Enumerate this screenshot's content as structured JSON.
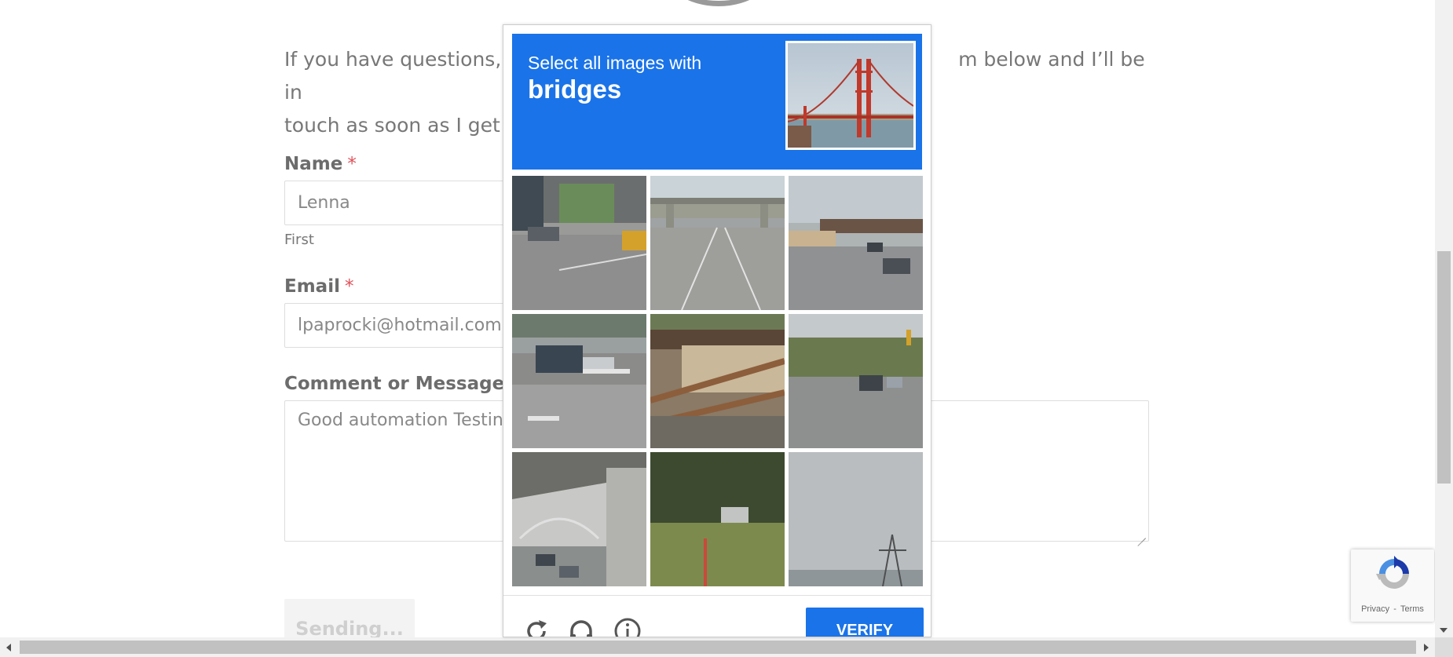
{
  "page": {
    "intro_left": "If you have questions, su",
    "intro_right": "m below and I’ll be in",
    "intro_line2": "touch as soon as I get it!"
  },
  "form": {
    "name_label": "Name",
    "name_value": "Lenna",
    "name_sublabel": "First",
    "email_label": "Email",
    "email_value": "lpaprocki@hotmail.com",
    "message_label": "Comment or Message",
    "message_value": "Good automation Testing",
    "required_mark": "*",
    "submit_label": "Sending..."
  },
  "captcha": {
    "prompt": "Select all images with",
    "target": "bridges",
    "verify_label": "VERIFY",
    "tiles": [
      {
        "name": "tile-1"
      },
      {
        "name": "tile-2"
      },
      {
        "name": "tile-3"
      },
      {
        "name": "tile-4"
      },
      {
        "name": "tile-5"
      },
      {
        "name": "tile-6"
      },
      {
        "name": "tile-7"
      },
      {
        "name": "tile-8"
      },
      {
        "name": "tile-9"
      }
    ],
    "icons": [
      "reload-icon",
      "audio-icon",
      "info-icon"
    ]
  },
  "recaptcha_badge": {
    "privacy": "Privacy",
    "separator": "-",
    "terms": "Terms"
  },
  "colors": {
    "captcha_blue": "#1a73e8",
    "required_red": "#e0525a"
  }
}
